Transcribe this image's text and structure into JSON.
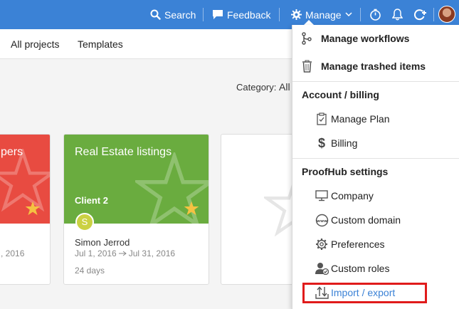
{
  "topbar": {
    "search_label": "Search",
    "feedback_label": "Feedback",
    "manage_label": "Manage",
    "icons": [
      "timer-icon",
      "bell-icon",
      "add-circle-icon",
      "avatar"
    ],
    "color": "#3b82d6"
  },
  "subnav": {
    "tabs": [
      "All projects",
      "Templates"
    ]
  },
  "filter": {
    "category_label": "Category:",
    "category_value": "All"
  },
  "cards": [
    {
      "title_fragment": "pers",
      "dates_fragment": ", 2016",
      "color": "#e84b41"
    },
    {
      "title": "Real Estate listings",
      "client": "Client 2",
      "owner_initial": "S",
      "owner_name": "Simon Jerrod",
      "start_date": "Jul 1, 2016",
      "end_date": "Jul 31, 2016",
      "duration": "24 days",
      "color": "#6aac3f"
    }
  ],
  "manage_menu": {
    "items_top": [
      {
        "label": "Manage workflows",
        "icon": "workflow-icon"
      },
      {
        "label": "Manage trashed items",
        "icon": "trash-icon"
      }
    ],
    "account_heading": "Account / billing",
    "account_items": [
      {
        "label": "Manage Plan",
        "icon": "clipboard-icon"
      },
      {
        "label": "Billing",
        "icon": "dollar-icon"
      }
    ],
    "settings_heading": "ProofHub settings",
    "settings_items": [
      {
        "label": "Company",
        "icon": "monitor-icon"
      },
      {
        "label": "Custom domain",
        "icon": "www-globe-icon"
      },
      {
        "label": "Preferences",
        "icon": "gear-icon"
      },
      {
        "label": "Custom roles",
        "icon": "user-check-icon"
      },
      {
        "label": "Import / export",
        "icon": "import-export-icon"
      }
    ],
    "highlight_color": "#e01b1b"
  }
}
